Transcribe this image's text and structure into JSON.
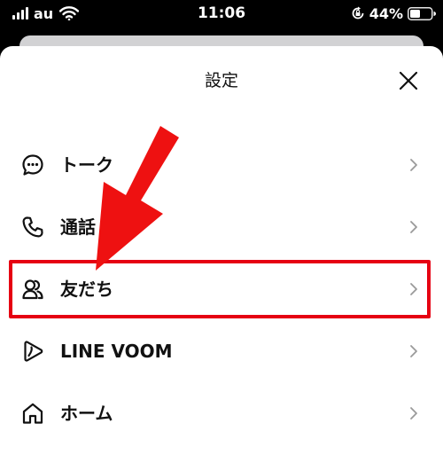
{
  "status_bar": {
    "carrier": "au",
    "time": "11:06",
    "battery": "44%"
  },
  "settings": {
    "title": "設定",
    "items": [
      {
        "label": "トーク",
        "icon": "chat-bubble-icon"
      },
      {
        "label": "通話",
        "icon": "phone-icon"
      },
      {
        "label": "友だち",
        "icon": "friends-icon"
      },
      {
        "label": "LINE VOOM",
        "icon": "voom-play-icon"
      },
      {
        "label": "ホーム",
        "icon": "home-icon"
      }
    ]
  },
  "colors": {
    "highlight": "#e60012",
    "arrow": "#ee1111"
  }
}
